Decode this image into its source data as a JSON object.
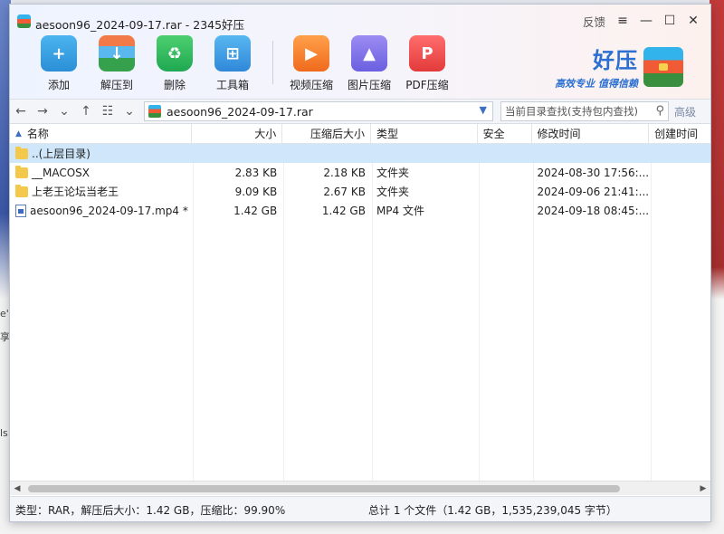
{
  "window": {
    "title": "aesoon96_2024-09-17.rar - 2345好压",
    "feedback": "反馈"
  },
  "toolbar": [
    {
      "label": "添加",
      "icon": "add-archive-icon"
    },
    {
      "label": "解压到",
      "icon": "extract-icon"
    },
    {
      "label": "删除",
      "icon": "recycle-delete-icon"
    },
    {
      "label": "工具箱",
      "icon": "toolbox-icon"
    },
    {
      "label": "视频压缩",
      "icon": "video-compress-icon"
    },
    {
      "label": "图片压缩",
      "icon": "image-compress-icon"
    },
    {
      "label": "PDF压缩",
      "icon": "pdf-compress-icon"
    }
  ],
  "brand": {
    "name": "好压",
    "slogan": "高效专业  值得信赖"
  },
  "nav": {
    "path": "aesoon96_2024-09-17.rar",
    "search_placeholder": "当前目录查找(支持包内查找)",
    "advanced": "高级"
  },
  "columns": {
    "name": "名称",
    "size": "大小",
    "compressed": "压缩后大小",
    "type": "类型",
    "security": "安全",
    "modified": "修改时间",
    "created": "创建时间"
  },
  "rows": [
    {
      "name": "..(上层目录)",
      "size": "",
      "compressed": "",
      "type": "",
      "security": "",
      "modified": "",
      "created": "",
      "kind": "folder"
    },
    {
      "name": "__MACOSX",
      "size": "2.83 KB",
      "compressed": "2.18 KB",
      "type": "文件夹",
      "security": "",
      "modified": "2024-08-30 17:56:...",
      "created": "",
      "kind": "folder"
    },
    {
      "name": "上老王论坛当老王",
      "size": "9.09 KB",
      "compressed": "2.67 KB",
      "type": "文件夹",
      "security": "",
      "modified": "2024-09-06 21:41:...",
      "created": "",
      "kind": "folder"
    },
    {
      "name": "aesoon96_2024-09-17.mp4 *",
      "size": "1.42 GB",
      "compressed": "1.42 GB",
      "type": "MP4 文件",
      "security": "",
      "modified": "2024-09-18 08:45:...",
      "created": "",
      "kind": "file"
    }
  ],
  "status": {
    "left": "类型：RAR，解压后大小：1.42 GB，压缩比：99.90%",
    "right": "总计 1 个文件（1.42 GB，1,535,239,045 字节）"
  },
  "background": {
    "glyphs": [
      "e'",
      "享",
      "ls"
    ]
  }
}
